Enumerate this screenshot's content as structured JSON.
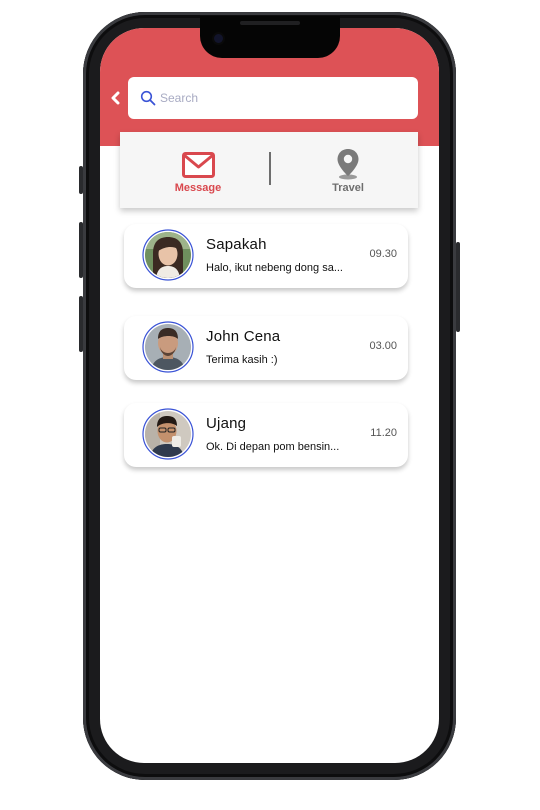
{
  "search": {
    "placeholder": "Search"
  },
  "tabs": [
    {
      "label": "Message",
      "icon": "mail-icon",
      "active": true,
      "color": "#d9484e"
    },
    {
      "label": "Travel",
      "icon": "location-pin-icon",
      "active": false,
      "color": "#6e6e6e"
    }
  ],
  "chats": [
    {
      "name": "Sapakah",
      "message": "Halo, ikut nebeng dong sa...",
      "time": "09.30"
    },
    {
      "name": "John Cena",
      "message": "Terima kasih :)",
      "time": "03.00"
    },
    {
      "name": "Ujang",
      "message": "Ok. Di depan pom bensin...",
      "time": "11.20"
    }
  ],
  "colors": {
    "header": "#dd5256",
    "accent": "#d9484e",
    "avatar_ring": "#3a53d6"
  }
}
